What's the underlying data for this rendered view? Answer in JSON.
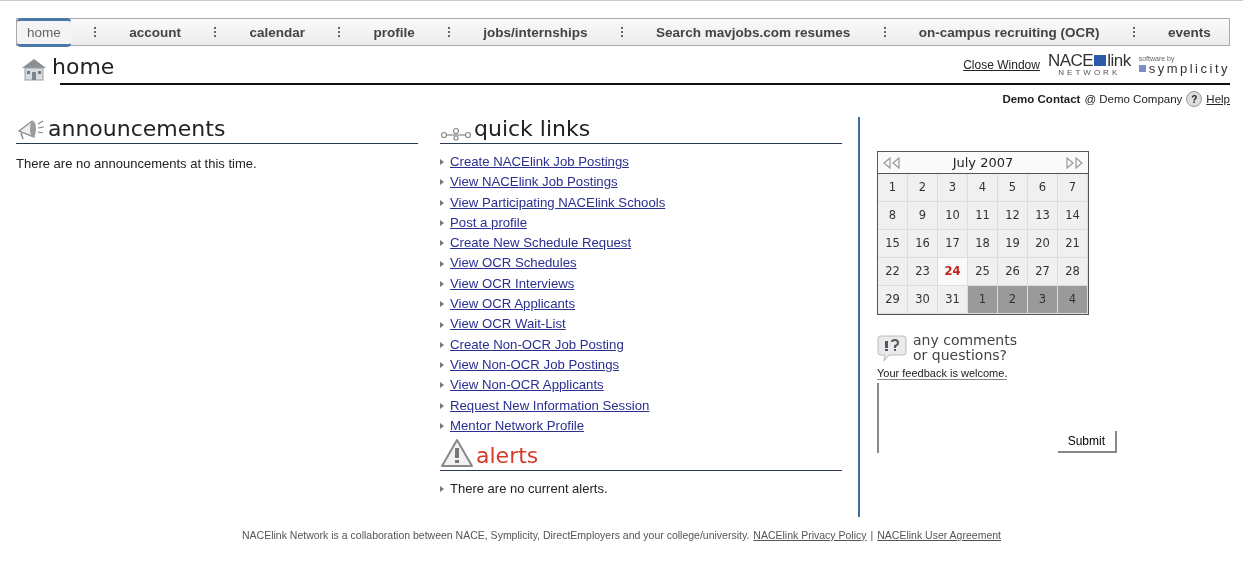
{
  "nav": [
    {
      "label": "home",
      "selected": true
    },
    {
      "label": "account",
      "selected": false
    },
    {
      "label": "calendar",
      "selected": false
    },
    {
      "label": "profile",
      "selected": false
    },
    {
      "label": "jobs/internships",
      "selected": false
    },
    {
      "label": "Search mavjobs.com resumes",
      "selected": false
    },
    {
      "label": "on-campus recruiting (OCR)",
      "selected": false
    },
    {
      "label": "events",
      "selected": false
    }
  ],
  "page_title": "home",
  "header": {
    "close_link": "Close Window",
    "nace_logo": {
      "main_left": "NACE",
      "main_right": "link",
      "sub": "NETWORK"
    },
    "symplicity_logo": {
      "tagline": "software by",
      "name": "symplicity"
    }
  },
  "user": {
    "name": "Demo Contact",
    "at": "@ Demo Company",
    "help_icon": "?",
    "help_link": "Help"
  },
  "announcements": {
    "title": "announcements",
    "text": "There are no announcements at this time."
  },
  "quick_links": {
    "title": "quick links",
    "links": [
      "Create NACElink Job Postings",
      "View NACElink Job Postings",
      "View Participating NACElink Schools",
      "Post a profile",
      "Create New Schedule Request",
      "View OCR Schedules",
      "View OCR Interviews",
      "View OCR Applicants",
      "View OCR Wait-List",
      "Create Non-OCR Job Posting",
      "View Non-OCR Job Postings",
      "View Non-OCR Applicants",
      "Request New Information Session",
      "Mentor Network Profile"
    ]
  },
  "alerts": {
    "title": "alerts",
    "items": [
      "There are no current alerts."
    ]
  },
  "calendar": {
    "month": "July 2007",
    "weeks": [
      [
        {
          "label": "1",
          "kind": "day"
        },
        {
          "label": "2",
          "kind": "day"
        },
        {
          "label": "3",
          "kind": "day"
        },
        {
          "label": "4",
          "kind": "day"
        },
        {
          "label": "5",
          "kind": "day"
        },
        {
          "label": "6",
          "kind": "day"
        },
        {
          "label": "7",
          "kind": "day"
        }
      ],
      [
        {
          "label": "8",
          "kind": "day"
        },
        {
          "label": "9",
          "kind": "day"
        },
        {
          "label": "10",
          "kind": "day"
        },
        {
          "label": "11",
          "kind": "day"
        },
        {
          "label": "12",
          "kind": "day"
        },
        {
          "label": "13",
          "kind": "day"
        },
        {
          "label": "14",
          "kind": "day"
        }
      ],
      [
        {
          "label": "15",
          "kind": "day"
        },
        {
          "label": "16",
          "kind": "day"
        },
        {
          "label": "17",
          "kind": "day"
        },
        {
          "label": "18",
          "kind": "day"
        },
        {
          "label": "19",
          "kind": "day"
        },
        {
          "label": "20",
          "kind": "day"
        },
        {
          "label": "21",
          "kind": "day"
        }
      ],
      [
        {
          "label": "22",
          "kind": "day"
        },
        {
          "label": "23",
          "kind": "day"
        },
        {
          "label": "24",
          "kind": "today"
        },
        {
          "label": "25",
          "kind": "day"
        },
        {
          "label": "26",
          "kind": "day"
        },
        {
          "label": "27",
          "kind": "day"
        },
        {
          "label": "28",
          "kind": "day"
        }
      ],
      [
        {
          "label": "29",
          "kind": "day"
        },
        {
          "label": "30",
          "kind": "day"
        },
        {
          "label": "31",
          "kind": "day"
        },
        {
          "label": "1",
          "kind": "other"
        },
        {
          "label": "2",
          "kind": "other"
        },
        {
          "label": "3",
          "kind": "other"
        },
        {
          "label": "4",
          "kind": "other"
        }
      ]
    ]
  },
  "feedback": {
    "title_line1": "any comments",
    "title_line2": "or questions?",
    "prompt": "Your feedback is welcome.",
    "submit": "Submit"
  },
  "footer": {
    "text": "NACElink Network is a collaboration between NACE, Symplicity, DirectEmployers and your college/university.",
    "links": [
      "NACElink Privacy Policy",
      "NACElink User Agreement"
    ],
    "separator": "|"
  }
}
